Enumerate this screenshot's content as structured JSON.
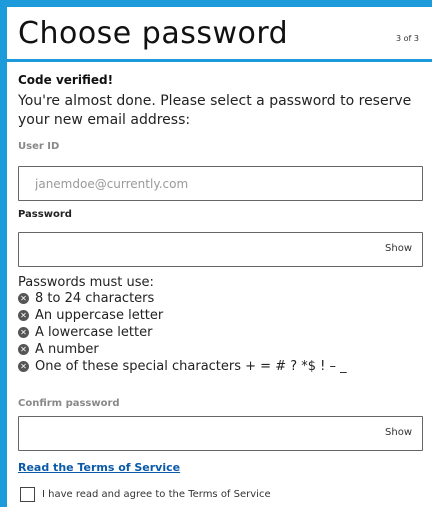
{
  "header": {
    "title": "Choose password",
    "step": "3 of 3"
  },
  "status": "Code verified!",
  "intro": "You're almost done. Please select a password to reserve your new email address:",
  "user_id": {
    "label": "User ID",
    "placeholder": "janemdoe@currently.com"
  },
  "password": {
    "label": "Password",
    "show_label": "Show"
  },
  "rules": {
    "title": "Passwords must use:",
    "items": [
      "8 to 24 characters",
      "An uppercase letter",
      "A lowercase letter",
      "A number",
      "One of these special characters + = # ? *$ ! – _"
    ]
  },
  "confirm": {
    "label": "Confirm password",
    "show_label": "Show"
  },
  "terms": {
    "link": "Read the Terms of Service",
    "checkbox_label": "I have read and agree to the Terms of Service"
  },
  "colors": {
    "accent": "#1d9ad9",
    "link": "#0a5aa8"
  }
}
